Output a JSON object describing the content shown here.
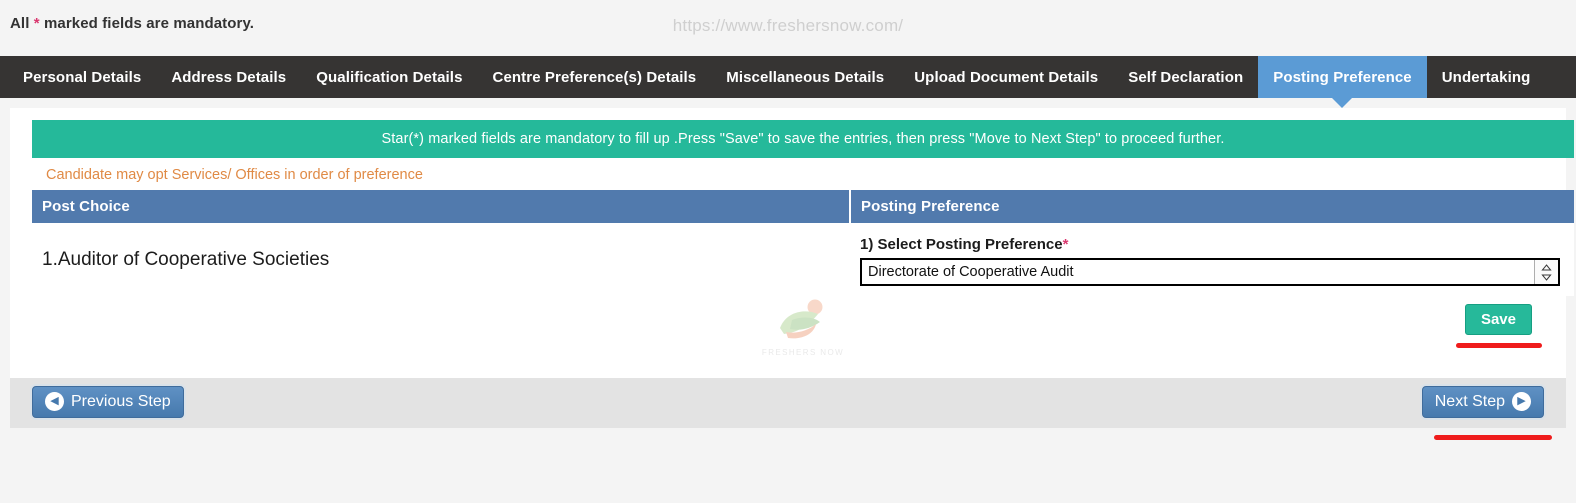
{
  "topbar": {
    "mandatory_prefix": "All",
    "mandatory_star": "*",
    "mandatory_suffix": "marked fields are mandatory.",
    "site_watermark": "https://www.freshersnow.com/"
  },
  "tabs": [
    {
      "label": "Personal Details",
      "active": false
    },
    {
      "label": "Address Details",
      "active": false
    },
    {
      "label": "Qualification Details",
      "active": false
    },
    {
      "label": "Centre Preference(s) Details",
      "active": false
    },
    {
      "label": "Miscellaneous Details",
      "active": false
    },
    {
      "label": "Upload Document Details",
      "active": false
    },
    {
      "label": "Self Declaration",
      "active": false
    },
    {
      "label": "Posting Preference",
      "active": true
    },
    {
      "label": "Undertaking",
      "active": false
    }
  ],
  "alert": {
    "text": "Star(*) marked fields are mandatory to fill up .Press \"Save\" to save the entries, then press \"Move to Next Step\" to proceed further."
  },
  "hint": {
    "text": "Candidate may opt Services/ Offices in order of preference"
  },
  "table": {
    "headers": [
      "Post Choice",
      "Posting Preference"
    ],
    "rows": [
      {
        "post_choice": "1.Auditor of Cooperative Societies",
        "pref_label": "1) Select Posting Preference",
        "pref_star": "*",
        "pref_value": "Directorate of Cooperative Audit",
        "stepper_icon": "updown-arrow-icon"
      }
    ]
  },
  "watermark": {
    "label": "FRESHERS NOW"
  },
  "actions": {
    "save_label": "Save",
    "previous_label": "Previous Step",
    "next_label": "Next Step",
    "prev_icon": "chevron-left-circle-icon",
    "next_icon": "chevron-right-circle-icon"
  },
  "colors": {
    "tabbar_bg": "#363433",
    "active_tab": "#5b9bd5",
    "alert_green": "#25b99a",
    "table_header_blue": "#517aad",
    "hint_orange": "#e08a45",
    "star_pink": "#d9376e",
    "annotation_red": "#ef1c1c",
    "footer_gray": "#e3e3e3"
  }
}
